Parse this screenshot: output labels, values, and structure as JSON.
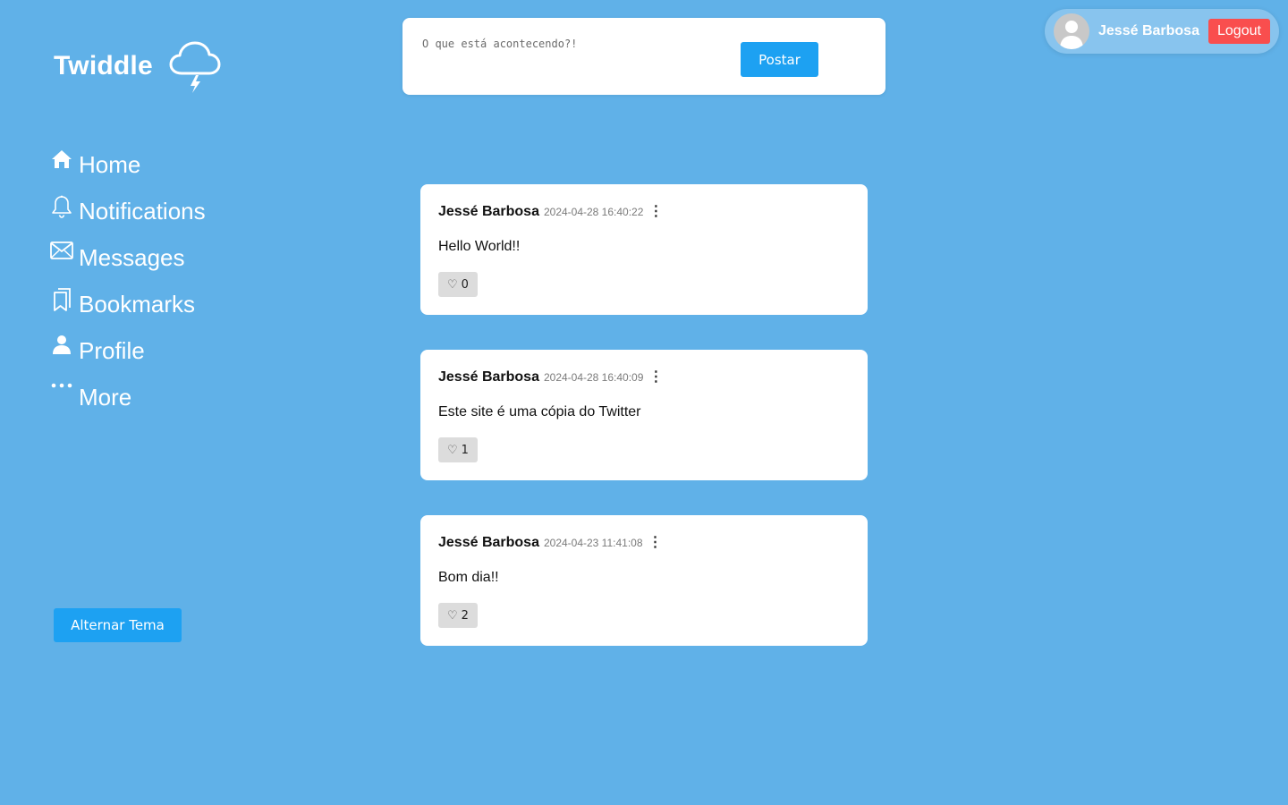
{
  "brand": {
    "title": "Twiddle",
    "icon": "storm-cloud-icon"
  },
  "sidebar": {
    "items": [
      {
        "label": "Home",
        "icon": "home-icon"
      },
      {
        "label": "Notifications",
        "icon": "bell-icon"
      },
      {
        "label": "Messages",
        "icon": "envelope-icon"
      },
      {
        "label": "Bookmarks",
        "icon": "bookmarks-icon"
      },
      {
        "label": "Profile",
        "icon": "person-icon"
      },
      {
        "label": "More",
        "icon": "ellipsis-icon"
      }
    ],
    "theme_button_label": "Alternar Tema"
  },
  "composer": {
    "placeholder": "O que está acontecendo?!",
    "value": "",
    "post_button_label": "Postar"
  },
  "user": {
    "name": "Jessé Barbosa",
    "logout_label": "Logout"
  },
  "posts": [
    {
      "author": "Jessé Barbosa",
      "date": "2024-04-28 16:40:22",
      "text": "Hello World!!",
      "likes": "0"
    },
    {
      "author": "Jessé Barbosa",
      "date": "2024-04-28 16:40:09",
      "text": "Este site é uma cópia do Twitter",
      "likes": "1"
    },
    {
      "author": "Jessé Barbosa",
      "date": "2024-04-23 11:41:08",
      "text": "Bom dia!!",
      "likes": "2"
    }
  ],
  "colors": {
    "background": "#60b1e8",
    "accent": "#1da1f2",
    "logout": "#f94e4e"
  }
}
